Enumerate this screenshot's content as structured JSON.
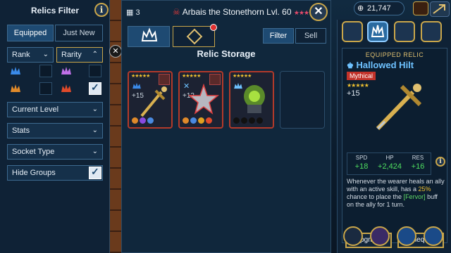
{
  "filter": {
    "title": "Relics Filter",
    "info": "i",
    "tabs": [
      {
        "label": "Equipped",
        "active": true
      },
      {
        "label": "Just New",
        "active": false
      }
    ],
    "rank_label": "Rank",
    "rarity_label": "Rarity",
    "rarity_colors": [
      "#3a8ae8",
      "#c070e8",
      "#e08a2a",
      "#e04a2a"
    ],
    "dropdowns": [
      {
        "label": "Current Level"
      },
      {
        "label": "Stats"
      },
      {
        "label": "Socket Type"
      },
      {
        "label": "Hide Groups"
      }
    ]
  },
  "storage": {
    "count": "3",
    "champion": "Arbais the Stonethorn Lvl. 60",
    "title": "Relic Storage",
    "filter_btn": "Filter",
    "sell_btn": "Sell",
    "relics": [
      {
        "level": "+15",
        "color": "#8a2a22"
      },
      {
        "level": "+12",
        "color": "#8a2a22"
      },
      {
        "level": "",
        "color": "#8a2a22"
      }
    ]
  },
  "topbar": {
    "currency": "21,747"
  },
  "detail": {
    "label": "EQUIPPED RELIC",
    "name": "Hallowed Hilt",
    "rarity": "Mythical",
    "level": "+15",
    "stats": [
      {
        "label": "SPD",
        "value": "+18"
      },
      {
        "label": "HP",
        "value": "+2,424"
      },
      {
        "label": "RES",
        "value": "+16"
      }
    ],
    "desc_a": "Whenever the wearer heals an ally with an active skill, has a ",
    "desc_pct": "25%",
    "desc_b": " chance to place the ",
    "desc_buff": "[Fervor]",
    "desc_c": " buff on the ally for 1 turn.",
    "upgrade_btn": "Upgrade",
    "unequip_btn": "Unequip"
  }
}
